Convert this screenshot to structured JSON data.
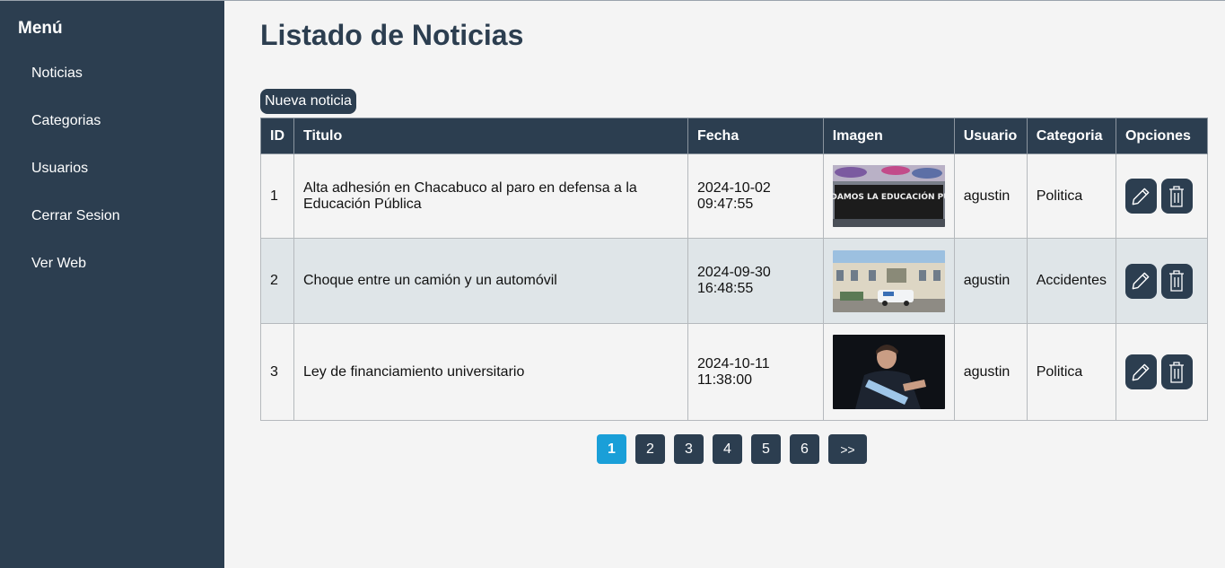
{
  "sidebar": {
    "title": "Menú",
    "items": [
      {
        "label": "Noticias"
      },
      {
        "label": "Categorias"
      },
      {
        "label": "Usuarios"
      },
      {
        "label": "Cerrar Sesion"
      },
      {
        "label": "Ver Web"
      }
    ]
  },
  "main": {
    "title": "Listado de Noticias",
    "new_button": "Nueva noticia"
  },
  "table": {
    "headers": [
      "ID",
      "Titulo",
      "Fecha",
      "Imagen",
      "Usuario",
      "Categoria",
      "Opciones"
    ],
    "rows": [
      {
        "id": "1",
        "title": "Alta adhesión en Chacabuco al paro en defensa a la Educación Pública",
        "date": "2024-10-02",
        "time": "09:47:55",
        "banner": "DEFENDAMOS LA EDUCACIÓN PÚBLICA",
        "user": "agustin",
        "category": "Politica"
      },
      {
        "id": "2",
        "title": "Choque entre un camión y un automóvil",
        "date": "2024-09-30",
        "time": "16:48:55",
        "user": "agustin",
        "category": "Accidentes"
      },
      {
        "id": "3",
        "title": "Ley de financiamiento universitario",
        "date": "2024-10-11",
        "time": "11:38:00",
        "user": "agustin",
        "category": "Politica"
      }
    ],
    "icons": {
      "edit": "pencil-icon",
      "delete": "trash-icon"
    }
  },
  "pagination": {
    "pages": [
      "1",
      "2",
      "3",
      "4",
      "5",
      "6"
    ],
    "next": ">>",
    "active": "1"
  },
  "colors": {
    "sidebar": "#2c3e50",
    "accent": "#1a9fd8",
    "row_alt": "#dfe5e8"
  }
}
